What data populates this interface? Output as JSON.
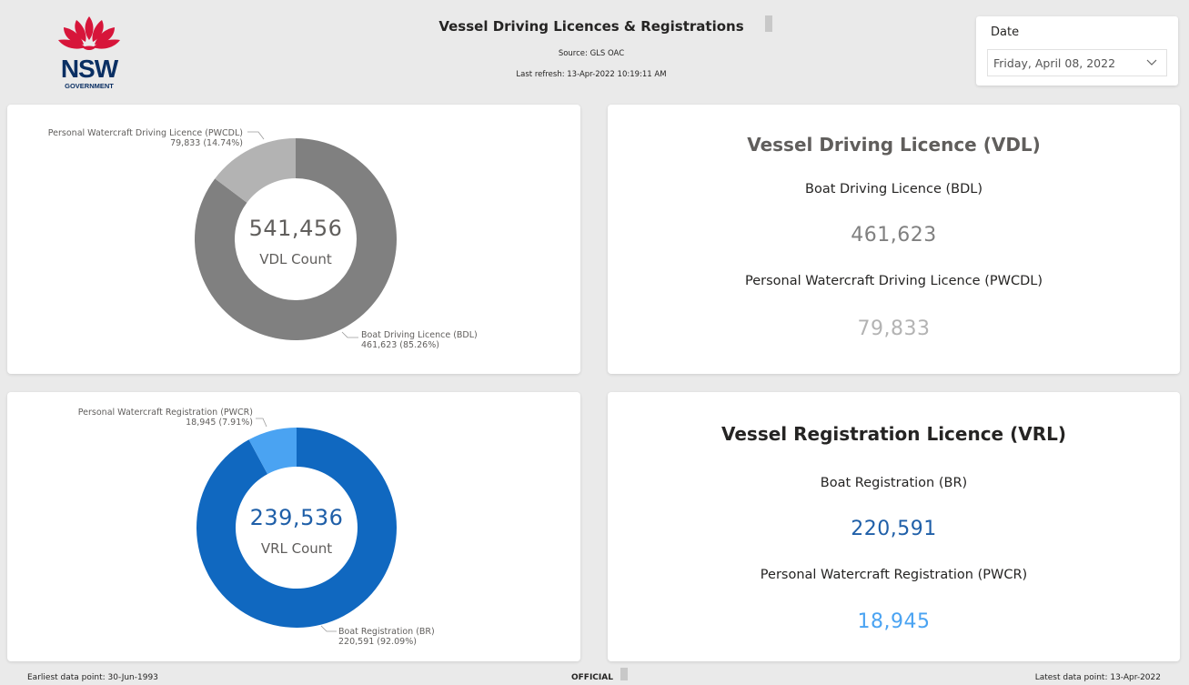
{
  "header": {
    "logo_main": "NSW",
    "logo_sub": "GOVERNMENT",
    "title": "Vessel Driving Licences & Registrations",
    "source": "Source: GLS OAC",
    "last_refresh": "Last refresh: 13-Apr-2022 10:19:11 AM"
  },
  "date_filter": {
    "label": "Date",
    "value": "Friday, April 08, 2022"
  },
  "vdl_chart": {
    "center_value": "541,456",
    "center_label": "VDL Count",
    "label_pwcdl_name": "Personal Watercraft Driving Licence (PWCDL)",
    "label_pwcdl_value": "79,833 (14.74%)",
    "label_bdl_name": "Boat Driving Licence (BDL)",
    "label_bdl_value": "461,623 (85.26%)"
  },
  "vrl_chart": {
    "center_value": "239,536",
    "center_label": "VRL Count",
    "label_pwcr_name": "Personal Watercraft Registration (PWCR)",
    "label_pwcr_value": "18,945 (7.91%)",
    "label_br_name": "Boat Registration (BR)",
    "label_br_value": "220,591 (92.09%)"
  },
  "vdl_card": {
    "heading": "Vessel Driving Licence (VDL)",
    "bdl_label": "Boat Driving Licence (BDL)",
    "bdl_value": "461,623",
    "pwcdl_label": "Personal Watercraft Driving Licence (PWCDL)",
    "pwcdl_value": "79,833"
  },
  "vrl_card": {
    "heading": "Vessel Registration Licence (VRL)",
    "br_label": "Boat Registration (BR)",
    "br_value": "220,591",
    "pwcr_label": "Personal Watercraft Registration (PWCR)",
    "pwcr_value": "18,945"
  },
  "footer": {
    "earliest": "Earliest data point: 30-Jun-1993",
    "classification": "OFFICIAL",
    "latest": "Latest data point: 13-Apr-2022"
  },
  "colors": {
    "bdl": "#808080",
    "pwcdl": "#b3b3b3",
    "br": "#1068c0",
    "pwcr": "#4aa3f2",
    "logo_red": "#d7153a",
    "logo_navy": "#0a2f63"
  },
  "icons": {
    "logo": "nsw-waratah-logo",
    "dropdown": "chevron-down-icon"
  },
  "chart_data": [
    {
      "type": "pie",
      "categories": [
        "Boat Driving Licence (BDL)",
        "Personal Watercraft Driving Licence (PWCDL)"
      ],
      "values": [
        461623,
        79833
      ],
      "percentages": [
        85.26,
        14.74
      ]
    },
    {
      "type": "pie",
      "categories": [
        "Boat Registration (BR)",
        "Personal Watercraft Registration (PWCR)"
      ],
      "values": [
        220591,
        18945
      ],
      "percentages": [
        92.09,
        7.91
      ]
    }
  ]
}
